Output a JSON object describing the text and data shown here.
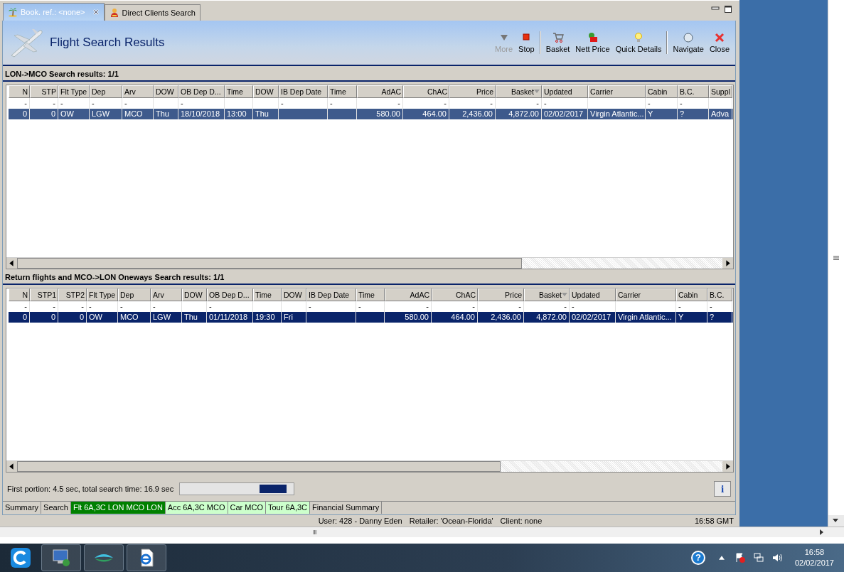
{
  "tabs": [
    {
      "label": "Book. ref.: <none>",
      "selected": true,
      "closable": true
    },
    {
      "label": "Direct Clients Search",
      "selected": false,
      "closable": false
    }
  ],
  "header": {
    "title": "Flight Search Results"
  },
  "toolbar_groups": [
    [
      {
        "label": "More",
        "disabled": true
      },
      {
        "label": "Stop",
        "disabled": false
      }
    ],
    [
      {
        "label": "Basket",
        "disabled": false
      },
      {
        "label": "Nett Price",
        "disabled": false
      },
      {
        "label": "Quick Details",
        "disabled": false
      }
    ],
    [
      {
        "label": "Navigate",
        "disabled": false
      },
      {
        "label": "Close",
        "disabled": false
      }
    ]
  ],
  "results": [
    {
      "title": "LON->MCO Search results: 1/1",
      "row": {
        "selected": true,
        "focused": false
      },
      "columns": [
        {
          "label": "N",
          "filter": "-",
          "cell": "0"
        },
        {
          "label": "STP",
          "filter": "-",
          "cell": "0"
        },
        {
          "label": "Flt Type",
          "filter": "-",
          "cell": "OW"
        },
        {
          "label": "Dep",
          "filter": "-",
          "cell": "LGW"
        },
        {
          "label": "Arv",
          "filter": "-",
          "cell": "MCO"
        },
        {
          "label": "DOW",
          "cell": "Thu"
        },
        {
          "label": "OB Dep D...",
          "filter": "-",
          "cell": "18/10/2018"
        },
        {
          "label": "Time",
          "cell": "13:00"
        },
        {
          "label": "DOW",
          "cell": "Thu"
        },
        {
          "label": "IB Dep Date",
          "filter": "-"
        },
        {
          "label": "Time",
          "filter": "-"
        },
        {
          "label": "AdAC",
          "filter": "-",
          "cell": "580.00"
        },
        {
          "label": "ChAC",
          "filter": "-",
          "cell": "464.00"
        },
        {
          "label": "Price",
          "filter": "-",
          "cell": "2,436.00"
        },
        {
          "label": "Basket",
          "sorted": true,
          "filter": "-",
          "cell": "4,872.00"
        },
        {
          "label": "Updated",
          "filter": "-",
          "cell": "02/02/2017"
        },
        {
          "label": "Carrier",
          "cell": "Virgin Atlantic..."
        },
        {
          "label": "Cabin",
          "filter": "-",
          "cell": "Y"
        },
        {
          "label": "B.C.",
          "filter": "-",
          "cell": "?"
        },
        {
          "label": "Suppl",
          "cell": "Adva"
        }
      ]
    },
    {
      "title": "Return flights and MCO->LON Oneways Search results: 1/1",
      "row": {
        "selected": true,
        "focused": true
      },
      "columns": [
        {
          "label": "N",
          "filter": "-",
          "cell": "0"
        },
        {
          "label": "STP1",
          "filter": "-",
          "cell": "0"
        },
        {
          "label": "STP2",
          "filter": "-",
          "cell": "0"
        },
        {
          "label": "Flt Type",
          "filter": "-",
          "cell": "OW"
        },
        {
          "label": "Dep",
          "filter": "-",
          "cell": "MCO"
        },
        {
          "label": "Arv",
          "filter": "-",
          "cell": "LGW"
        },
        {
          "label": "DOW",
          "cell": "Thu"
        },
        {
          "label": "OB Dep D...",
          "filter": "-",
          "cell": "01/11/2018"
        },
        {
          "label": "Time",
          "cell": "19:30"
        },
        {
          "label": "DOW",
          "cell": "Fri"
        },
        {
          "label": "IB Dep Date",
          "filter": "-"
        },
        {
          "label": "Time",
          "filter": "-"
        },
        {
          "label": "AdAC",
          "filter": "-",
          "cell": "580.00"
        },
        {
          "label": "ChAC",
          "filter": "-",
          "cell": "464.00"
        },
        {
          "label": "Price",
          "filter": "-",
          "cell": "2,436.00"
        },
        {
          "label": "Basket",
          "sorted": true,
          "filter": "-",
          "cell": "4,872.00"
        },
        {
          "label": "Updated",
          "filter": "-",
          "cell": "02/02/2017"
        },
        {
          "label": "Carrier",
          "cell": "Virgin Atlantic..."
        },
        {
          "label": "Cabin",
          "filter": "-",
          "cell": "Y"
        },
        {
          "label": "B.C.",
          "filter": "-",
          "cell": "?"
        }
      ]
    }
  ],
  "progress": {
    "text": "First portion: 4.5 sec, total search time: 16.9 sec",
    "busy": true
  },
  "info_button": {
    "label": "i"
  },
  "bottom_tabs": [
    {
      "label": "Summary",
      "selected": false,
      "color": "#d4d0c8"
    },
    {
      "label": "Search",
      "selected": false,
      "color": "#d4d0c8"
    },
    {
      "label": "Flt 6A,3C LON MCO LON",
      "selected": true,
      "color": "#008000"
    },
    {
      "label": "Acc 6A,3C MCO",
      "selected": false,
      "color": "#ccffcc"
    },
    {
      "label": "Car MCO",
      "selected": false,
      "color": "#ccffcc"
    },
    {
      "label": "Tour 6A,3C",
      "selected": false,
      "color": "#ccffcc"
    },
    {
      "label": "Financial Summary",
      "selected": false,
      "color": "#d4d0c8"
    }
  ],
  "status_bar": {
    "user": "User: 428 - Danny Eden",
    "retailer": "Retailer: 'Ocean-Florida'",
    "client": "Client: none",
    "time": "16:58 GMT"
  },
  "scroll_grip": "III",
  "taskbar": {
    "help": "?",
    "clock_time": "16:58",
    "clock_date": "02/02/2017"
  }
}
